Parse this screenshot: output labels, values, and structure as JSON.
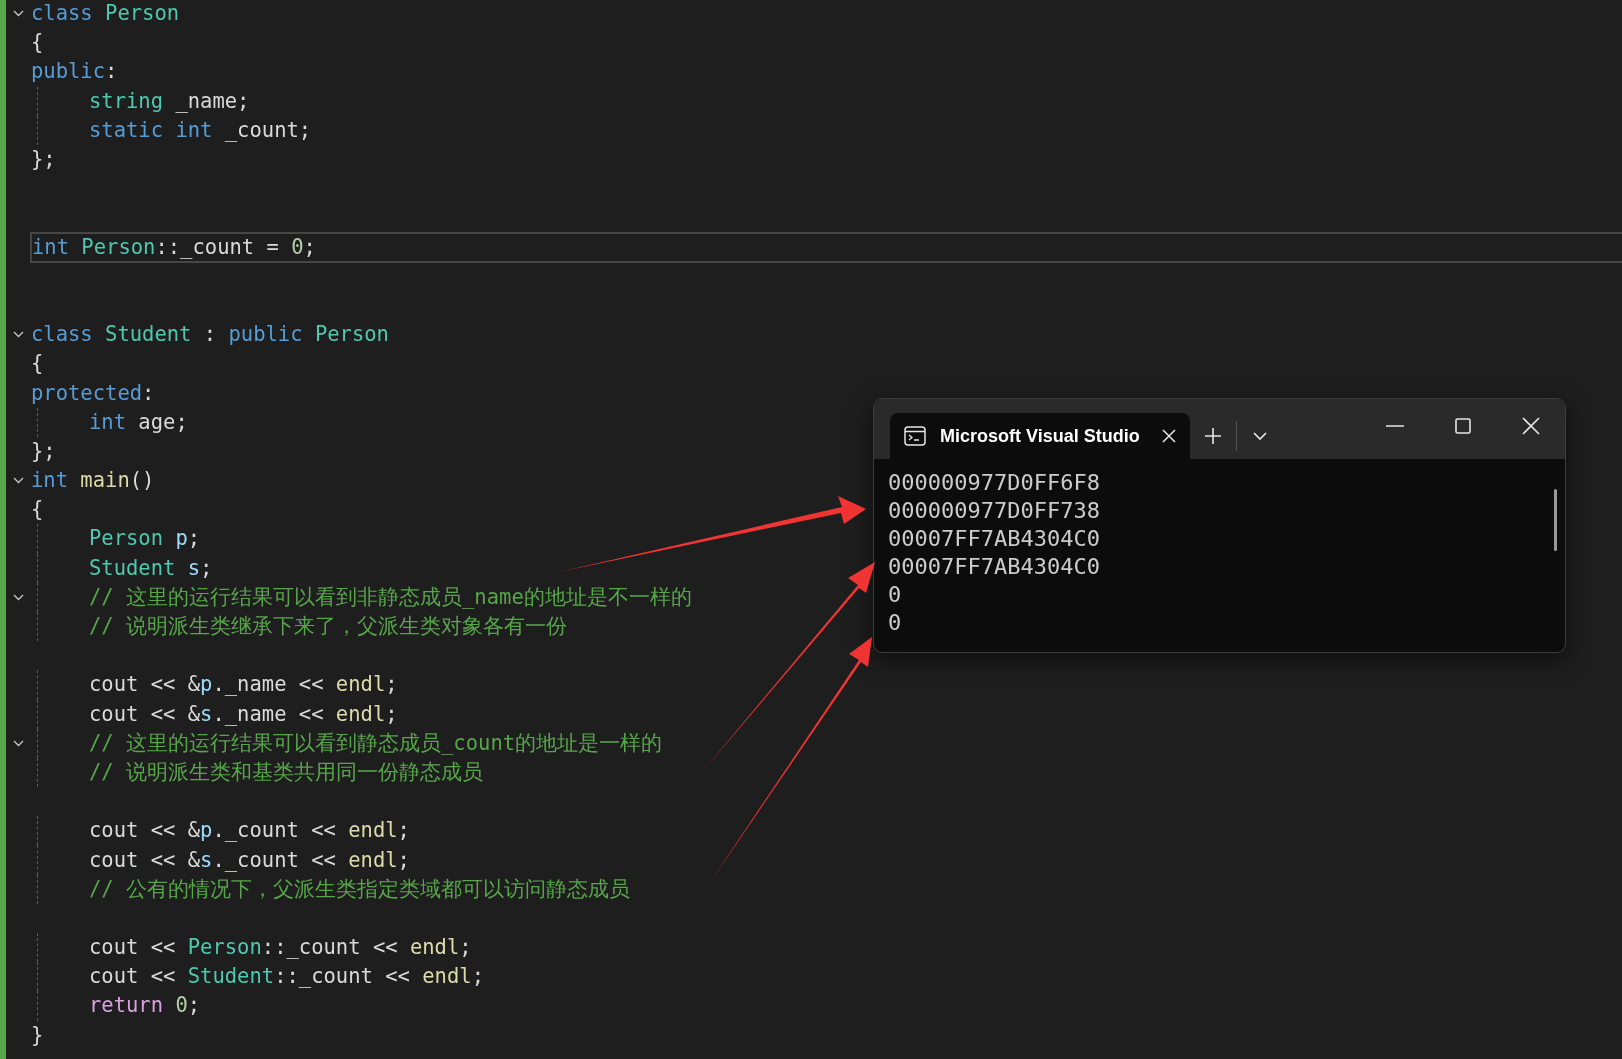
{
  "editor": {
    "lines": [
      {
        "kind": "code",
        "fold": true,
        "indented": false,
        "tokens": [
          {
            "t": "class",
            "kind": "keyword"
          },
          {
            "t": " Person",
            "kind": "type"
          }
        ]
      },
      {
        "kind": "code",
        "fold": false,
        "indented": false,
        "tokens": [
          {
            "t": "{",
            "kind": "plain"
          }
        ]
      },
      {
        "kind": "code",
        "fold": false,
        "indented": false,
        "tokens": [
          {
            "t": "public",
            "kind": "keyword"
          },
          {
            "t": ":",
            "kind": "plain"
          }
        ]
      },
      {
        "kind": "code",
        "fold": false,
        "indented": true,
        "tokens": [
          {
            "t": "string",
            "kind": "type"
          },
          {
            "t": " _name;",
            "kind": "plain"
          }
        ]
      },
      {
        "kind": "code",
        "fold": false,
        "indented": true,
        "tokens": [
          {
            "t": "static",
            "kind": "keyword"
          },
          {
            "t": " int",
            "kind": "keyword"
          },
          {
            "t": " _count;",
            "kind": "plain"
          }
        ]
      },
      {
        "kind": "code",
        "fold": false,
        "indented": false,
        "tokens": [
          {
            "t": "};",
            "kind": "plain"
          }
        ]
      },
      {
        "kind": "blank"
      },
      {
        "kind": "blank"
      },
      {
        "kind": "code",
        "fold": false,
        "indented": false,
        "current": true,
        "tokens": [
          {
            "t": "int",
            "kind": "keyword"
          },
          {
            "t": " Person",
            "kind": "type"
          },
          {
            "t": "::_count = ",
            "kind": "plain"
          },
          {
            "t": "0",
            "kind": "number"
          },
          {
            "t": ";",
            "kind": "plain"
          }
        ]
      },
      {
        "kind": "blank"
      },
      {
        "kind": "blank"
      },
      {
        "kind": "code",
        "fold": true,
        "indented": false,
        "tokens": [
          {
            "t": "class",
            "kind": "keyword"
          },
          {
            "t": " Student",
            "kind": "type"
          },
          {
            "t": " : ",
            "kind": "plain"
          },
          {
            "t": "public",
            "kind": "keyword"
          },
          {
            "t": " Person",
            "kind": "type"
          }
        ]
      },
      {
        "kind": "code",
        "fold": false,
        "indented": false,
        "tokens": [
          {
            "t": "{",
            "kind": "plain"
          }
        ]
      },
      {
        "kind": "code",
        "fold": false,
        "indented": false,
        "tokens": [
          {
            "t": "protected",
            "kind": "keyword"
          },
          {
            "t": ":",
            "kind": "plain"
          }
        ]
      },
      {
        "kind": "code",
        "fold": false,
        "indented": true,
        "tokens": [
          {
            "t": "int",
            "kind": "keyword"
          },
          {
            "t": " age;",
            "kind": "plain"
          }
        ]
      },
      {
        "kind": "code",
        "fold": false,
        "indented": false,
        "tokens": [
          {
            "t": "};",
            "kind": "plain"
          }
        ]
      },
      {
        "kind": "code",
        "fold": true,
        "indented": false,
        "tokens": [
          {
            "t": "int",
            "kind": "keyword"
          },
          {
            "t": " main",
            "kind": "func"
          },
          {
            "t": "()",
            "kind": "plain"
          }
        ]
      },
      {
        "kind": "code",
        "fold": false,
        "indented": false,
        "tokens": [
          {
            "t": "{",
            "kind": "plain"
          }
        ]
      },
      {
        "kind": "code",
        "fold": false,
        "indented": true,
        "tokens": [
          {
            "t": "Person",
            "kind": "type"
          },
          {
            "t": " p",
            "kind": "var"
          },
          {
            "t": ";",
            "kind": "plain"
          }
        ]
      },
      {
        "kind": "code",
        "fold": false,
        "indented": true,
        "tokens": [
          {
            "t": "Student",
            "kind": "type"
          },
          {
            "t": " s",
            "kind": "var"
          },
          {
            "t": ";",
            "kind": "plain"
          }
        ]
      },
      {
        "kind": "comment",
        "fold": true,
        "indented": true,
        "text": "// 这里的运行结果可以看到非静态成员_name的地址是不一样的"
      },
      {
        "kind": "comment",
        "fold": false,
        "indented": true,
        "text": "// 说明派生类继承下来了，父派生类对象各有一份"
      },
      {
        "kind": "blank"
      },
      {
        "kind": "code",
        "fold": false,
        "indented": true,
        "tokens": [
          {
            "t": "cout << &",
            "kind": "plain"
          },
          {
            "t": "p",
            "kind": "var"
          },
          {
            "t": "._name << ",
            "kind": "plain"
          },
          {
            "t": "endl",
            "kind": "func"
          },
          {
            "t": ";",
            "kind": "plain"
          }
        ]
      },
      {
        "kind": "code",
        "fold": false,
        "indented": true,
        "tokens": [
          {
            "t": "cout << &",
            "kind": "plain"
          },
          {
            "t": "s",
            "kind": "var"
          },
          {
            "t": "._name << ",
            "kind": "plain"
          },
          {
            "t": "endl",
            "kind": "func"
          },
          {
            "t": ";",
            "kind": "plain"
          }
        ]
      },
      {
        "kind": "comment",
        "fold": true,
        "indented": true,
        "text": "// 这里的运行结果可以看到静态成员_count的地址是一样的"
      },
      {
        "kind": "comment",
        "fold": false,
        "indented": true,
        "text": "// 说明派生类和基类共用同一份静态成员"
      },
      {
        "kind": "blank"
      },
      {
        "kind": "code",
        "fold": false,
        "indented": true,
        "tokens": [
          {
            "t": "cout << &",
            "kind": "plain"
          },
          {
            "t": "p",
            "kind": "var"
          },
          {
            "t": "._count << ",
            "kind": "plain"
          },
          {
            "t": "endl",
            "kind": "func"
          },
          {
            "t": ";",
            "kind": "plain"
          }
        ]
      },
      {
        "kind": "code",
        "fold": false,
        "indented": true,
        "tokens": [
          {
            "t": "cout << &",
            "kind": "plain"
          },
          {
            "t": "s",
            "kind": "var"
          },
          {
            "t": "._count << ",
            "kind": "plain"
          },
          {
            "t": "endl",
            "kind": "func"
          },
          {
            "t": ";",
            "kind": "plain"
          }
        ]
      },
      {
        "kind": "comment",
        "fold": false,
        "indented": true,
        "text": "// 公有的情况下，父派生类指定类域都可以访问静态成员"
      },
      {
        "kind": "blank"
      },
      {
        "kind": "code",
        "fold": false,
        "indented": true,
        "tokens": [
          {
            "t": "cout << ",
            "kind": "plain"
          },
          {
            "t": "Person",
            "kind": "type"
          },
          {
            "t": "::_count << ",
            "kind": "plain"
          },
          {
            "t": "endl",
            "kind": "func"
          },
          {
            "t": ";",
            "kind": "plain"
          }
        ]
      },
      {
        "kind": "code",
        "fold": false,
        "indented": true,
        "tokens": [
          {
            "t": "cout << ",
            "kind": "plain"
          },
          {
            "t": "Student",
            "kind": "type"
          },
          {
            "t": "::_count << ",
            "kind": "plain"
          },
          {
            "t": "endl",
            "kind": "func"
          },
          {
            "t": ";",
            "kind": "plain"
          }
        ]
      },
      {
        "kind": "code",
        "fold": false,
        "indented": true,
        "tokens": [
          {
            "t": "return",
            "kind": "control"
          },
          {
            "t": " 0",
            "kind": "number"
          },
          {
            "t": ";",
            "kind": "plain"
          }
        ]
      },
      {
        "kind": "code",
        "fold": false,
        "indented": false,
        "tokens": [
          {
            "t": "}",
            "kind": "plain"
          }
        ]
      }
    ]
  },
  "terminal": {
    "tab": {
      "title": "Microsoft Visual Studio",
      "selected": true
    },
    "output": [
      "000000977D0FF6F8",
      "000000977D0FF738",
      "00007FF7AB4304C0",
      "00007FF7AB4304C0",
      "0",
      "0"
    ]
  }
}
